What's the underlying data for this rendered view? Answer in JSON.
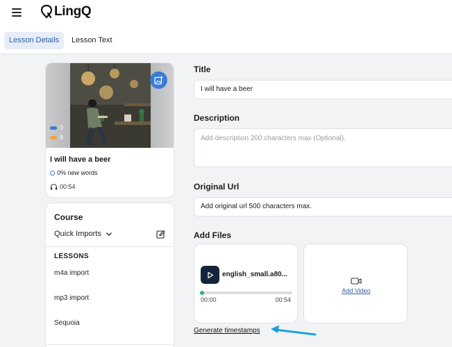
{
  "brand": {
    "name": "LingQ"
  },
  "tabs": [
    {
      "label": "Lesson Details",
      "active": true
    },
    {
      "label": "Lesson Text",
      "active": false
    }
  ],
  "lesson_card": {
    "title": "I will have a beer",
    "stat_blue": "0",
    "stat_orange": "8",
    "new_words": "0% new words",
    "duration": "00:54"
  },
  "course": {
    "title": "Course",
    "selected": "Quick Imports",
    "lessons_label": "LESSONS",
    "lessons": [
      "m4a import",
      "mp3 import",
      "Sequoia"
    ]
  },
  "form": {
    "title_label": "Title",
    "title_value": "I will have a beer",
    "description_label": "Description",
    "description_placeholder": "Add description 200 characters max (Optional).",
    "url_label": "Original Url",
    "url_placeholder": "Add original url 500 characters max.",
    "files_label": "Add Files"
  },
  "audio": {
    "file_name": "english_small.a80...",
    "time_start": "00:00",
    "time_end": "00:54",
    "progress": 0
  },
  "video": {
    "add_label": "Add Video"
  },
  "generate_timestamps": "Generate timestamps",
  "colors": {
    "accent": "#3a7bd5",
    "arrow": "#1ea0e0",
    "play_bg": "#14253b",
    "progress_dot": "#2db36b"
  }
}
